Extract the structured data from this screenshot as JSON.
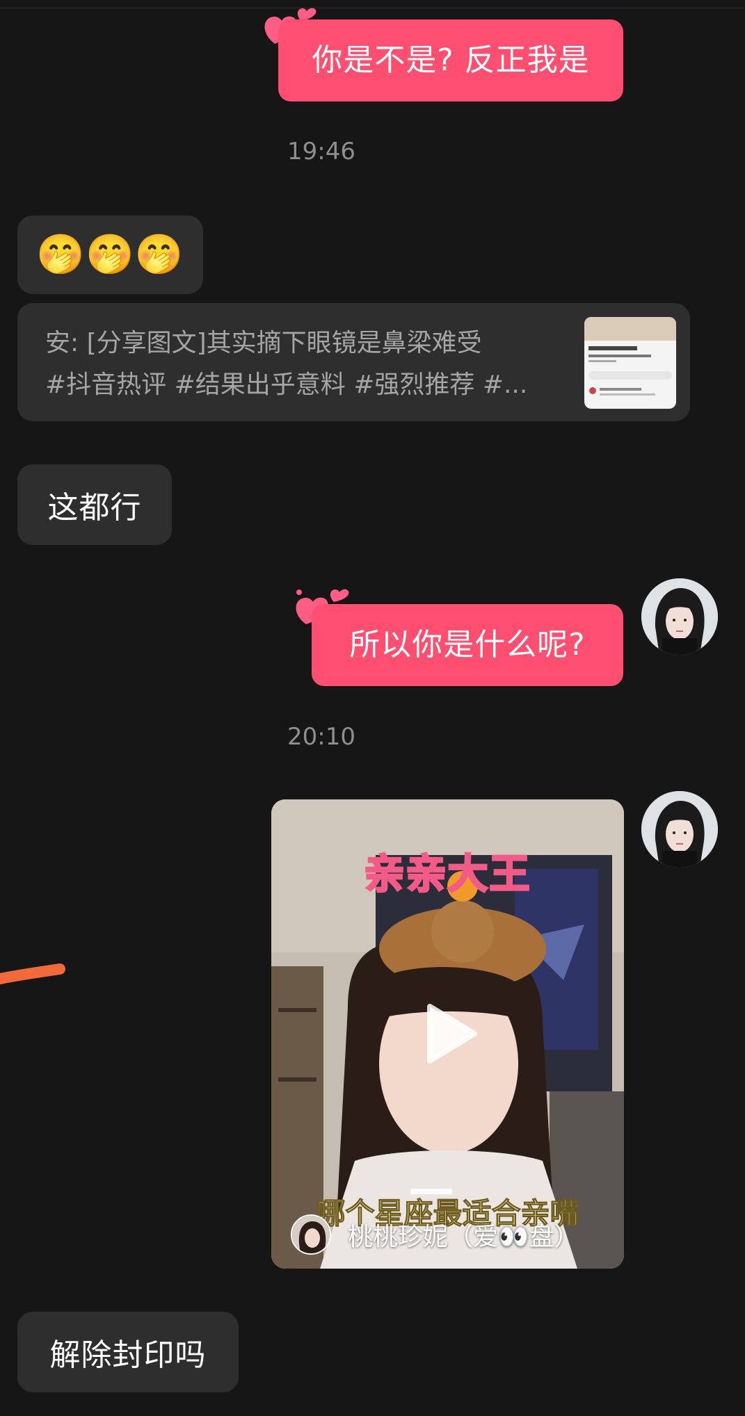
{
  "messages": {
    "m1": {
      "text": "你是不是? 反正我是"
    },
    "ts1": "19:46",
    "m2": {
      "emoji": "🤭🤭🤭"
    },
    "share": {
      "line1": "安: [分享图文]其实摘下眼镜是鼻梁难受",
      "line2": "#抖音热评 #结果出乎意料 #强烈推荐 #..."
    },
    "m3": {
      "text": "这都行"
    },
    "m4": {
      "text": "所以你是什么呢?"
    },
    "ts2": "20:10",
    "video": {
      "title": "亲亲大王",
      "caption": "哪个星座最适合亲嘴",
      "author": "桃桃珍妮（爱👀盘）"
    },
    "m5": {
      "text": "解除封印吗"
    }
  },
  "colors": {
    "background": "#161616",
    "outgoing_bubble": "#fe4f70",
    "incoming_bubble": "#2e2e2e",
    "timestamp": "#8f8f8f",
    "share_text": "#a5a5a5"
  },
  "icons": [
    "heart-sticker-icon",
    "play-icon",
    "avatar"
  ]
}
